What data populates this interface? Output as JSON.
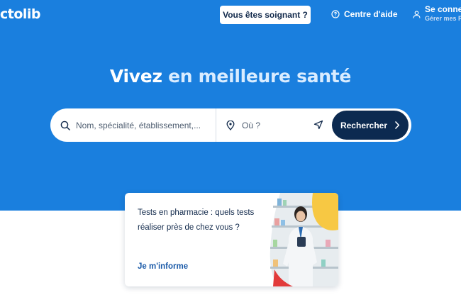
{
  "header": {
    "logo_text": "ctolib",
    "pro_button": "Vous êtes soignant ?",
    "help_label": "Centre d'aide",
    "account_line1": "Se connec",
    "account_line2": "Gérer mes R"
  },
  "hero": {
    "headline_part1": "Vivez ",
    "headline_part2": "en meilleure santé"
  },
  "search": {
    "name_placeholder": "Nom, spécialité, établissement,...",
    "where_placeholder": "Où ?",
    "button_label": "Rechercher"
  },
  "card": {
    "text": "Tests en pharmacie : quels tests réaliser près de chez vous ?",
    "link": "Je m'informe"
  },
  "colors": {
    "brand_blue": "#1a7fde",
    "navy": "#0c2a50",
    "accent_yellow": "#f7c843"
  }
}
